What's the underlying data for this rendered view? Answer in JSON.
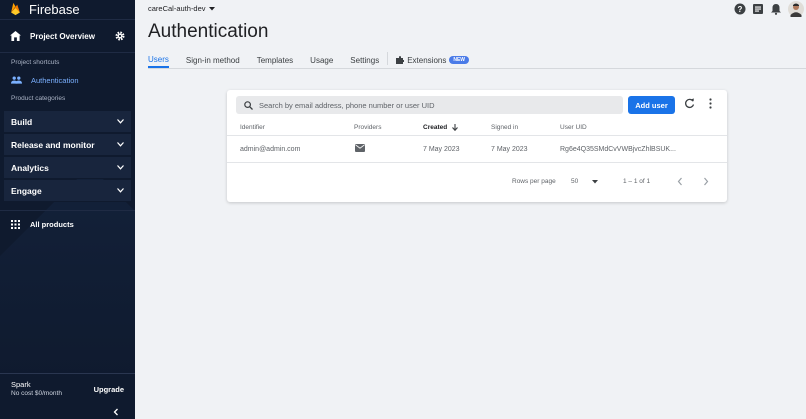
{
  "brand": {
    "name": "Firebase"
  },
  "sidebar": {
    "project_overview": "Project Overview",
    "shortcuts_title": "Project shortcuts",
    "shortcut_items": [
      {
        "label": "Authentication",
        "icon": "users-icon"
      }
    ],
    "categories_title": "Product categories",
    "categories": [
      {
        "label": "Build"
      },
      {
        "label": "Release and monitor"
      },
      {
        "label": "Analytics"
      },
      {
        "label": "Engage"
      }
    ],
    "all_products": "All products",
    "plan_name": "Spark",
    "plan_cost": "No cost $0/month",
    "upgrade": "Upgrade"
  },
  "topbar": {
    "project": "careCal-auth-dev"
  },
  "page": {
    "title": "Authentication",
    "tabs": [
      {
        "label": "Users",
        "active": true
      },
      {
        "label": "Sign-in method"
      },
      {
        "label": "Templates"
      },
      {
        "label": "Usage"
      },
      {
        "label": "Settings"
      }
    ],
    "extensions_tab": "Extensions",
    "new_badge": "NEW"
  },
  "users_table": {
    "search_placeholder": "Search by email address, phone number or user UID",
    "add_user": "Add user",
    "columns": [
      "Identifier",
      "Providers",
      "Created",
      "Signed in",
      "User UID"
    ],
    "rows": [
      {
        "identifier": "admin@admin.com",
        "provider_icon": "email-icon",
        "created": "7 May 2023",
        "signed_in": "7 May 2023",
        "uid": "Rg6e4Q35SMdCvVWBjvcZhlBSUK..."
      }
    ],
    "rows_per_page_label": "Rows per page",
    "rows_per_page": "50",
    "range": "1 – 1 of 1"
  },
  "colors": {
    "accent": "#1a73e8",
    "sidebar_bg": "#0f1a2e",
    "active_link": "#7ab0ff"
  }
}
